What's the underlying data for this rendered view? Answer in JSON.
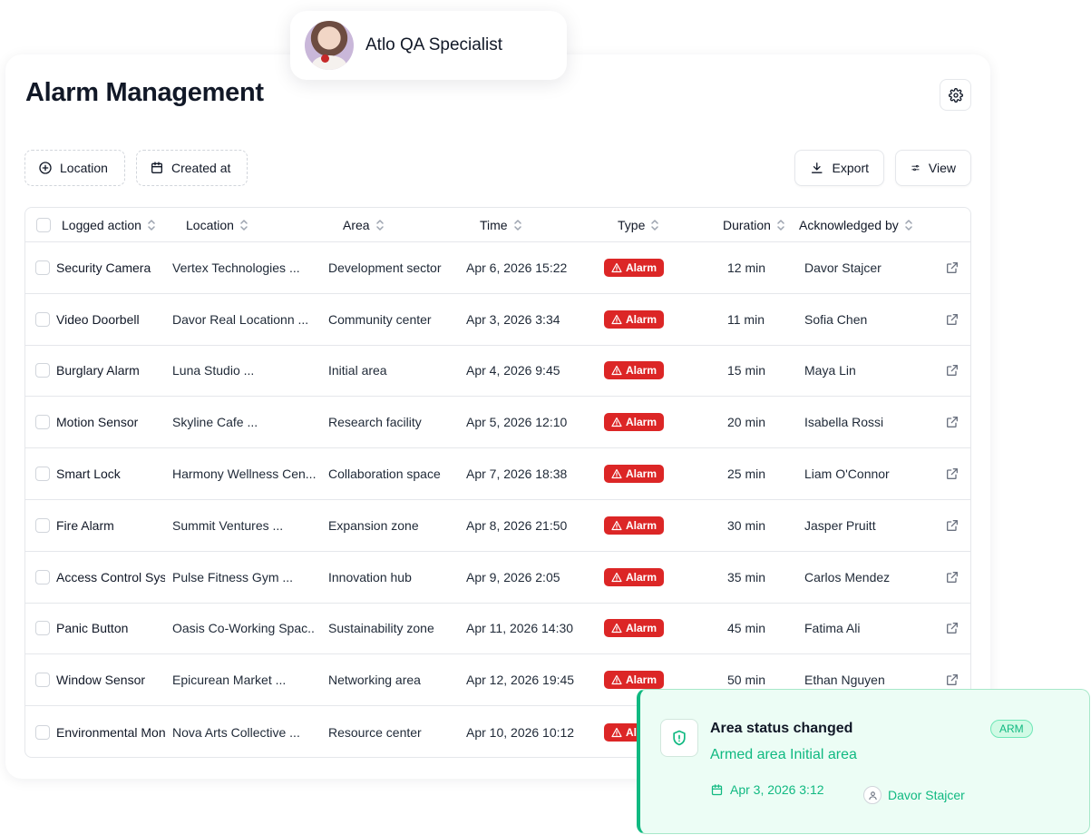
{
  "user": {
    "name": "Atlo QA Specialist"
  },
  "page": {
    "title": "Alarm Management"
  },
  "filters": {
    "location_label": "Location",
    "created_label": "Created at"
  },
  "actions": {
    "export_label": "Export",
    "view_label": "View"
  },
  "table": {
    "columns": [
      "Logged action",
      "Location",
      "Area",
      "Time",
      "Type",
      "Duration",
      "Acknowledged by"
    ],
    "rows": [
      {
        "action": "Security Camera",
        "location": "Vertex Technologies ...",
        "area": "Development sector",
        "time": "Apr 6, 2026 15:22",
        "type": "Alarm",
        "duration": "12 min",
        "ack": "Davor Stajcer"
      },
      {
        "action": "Video Doorbell",
        "location": "Davor Real Locationn ...",
        "area": "Community center",
        "time": "Apr 3, 2026 3:34",
        "type": "Alarm",
        "duration": "11 min",
        "ack": "Sofia Chen"
      },
      {
        "action": "Burglary Alarm",
        "location": "Luna Studio ...",
        "area": "Initial area",
        "time": "Apr 4, 2026 9:45",
        "type": "Alarm",
        "duration": "15 min",
        "ack": "Maya Lin"
      },
      {
        "action": "Motion Sensor",
        "location": "Skyline Cafe ...",
        "area": "Research facility",
        "time": "Apr 5, 2026 12:10",
        "type": "Alarm",
        "duration": "20 min",
        "ack": "Isabella Rossi"
      },
      {
        "action": "Smart Lock",
        "location": "Harmony Wellness Cen...",
        "area": "Collaboration space",
        "time": "Apr 7, 2026 18:38",
        "type": "Alarm",
        "duration": "25 min",
        "ack": "Liam O'Connor"
      },
      {
        "action": "Fire Alarm",
        "location": "Summit Ventures ...",
        "area": "Expansion zone",
        "time": "Apr 8, 2026 21:50",
        "type": "Alarm",
        "duration": "30 min",
        "ack": "Jasper Pruitt"
      },
      {
        "action": "Access Control System",
        "location": "Pulse Fitness Gym ...",
        "area": "Innovation hub",
        "time": "Apr 9, 2026 2:05",
        "type": "Alarm",
        "duration": "35 min",
        "ack": "Carlos Mendez"
      },
      {
        "action": "Panic Button",
        "location": "Oasis Co-Working Spac...",
        "area": "Sustainability zone",
        "time": "Apr 11, 2026 14:30",
        "type": "Alarm",
        "duration": "45 min",
        "ack": "Fatima Ali"
      },
      {
        "action": "Window Sensor",
        "location": "Epicurean Market ...",
        "area": "Networking area",
        "time": "Apr 12, 2026 19:45",
        "type": "Alarm",
        "duration": "50 min",
        "ack": "Ethan Nguyen"
      },
      {
        "action": "Environmental Monitor",
        "location": "Nova Arts Collective ...",
        "area": "Resource center",
        "time": "Apr 10, 2026 10:12",
        "type": "Alarm",
        "duration": "",
        "ack": ""
      }
    ]
  },
  "toast": {
    "title": "Area status changed",
    "badge": "ARM",
    "subtitle": "Armed area Initial area",
    "date": "Apr 3, 2026 3:12",
    "user": "Davor Stajcer"
  },
  "colors": {
    "alarm": "#dc2626",
    "success": "#10b981"
  }
}
